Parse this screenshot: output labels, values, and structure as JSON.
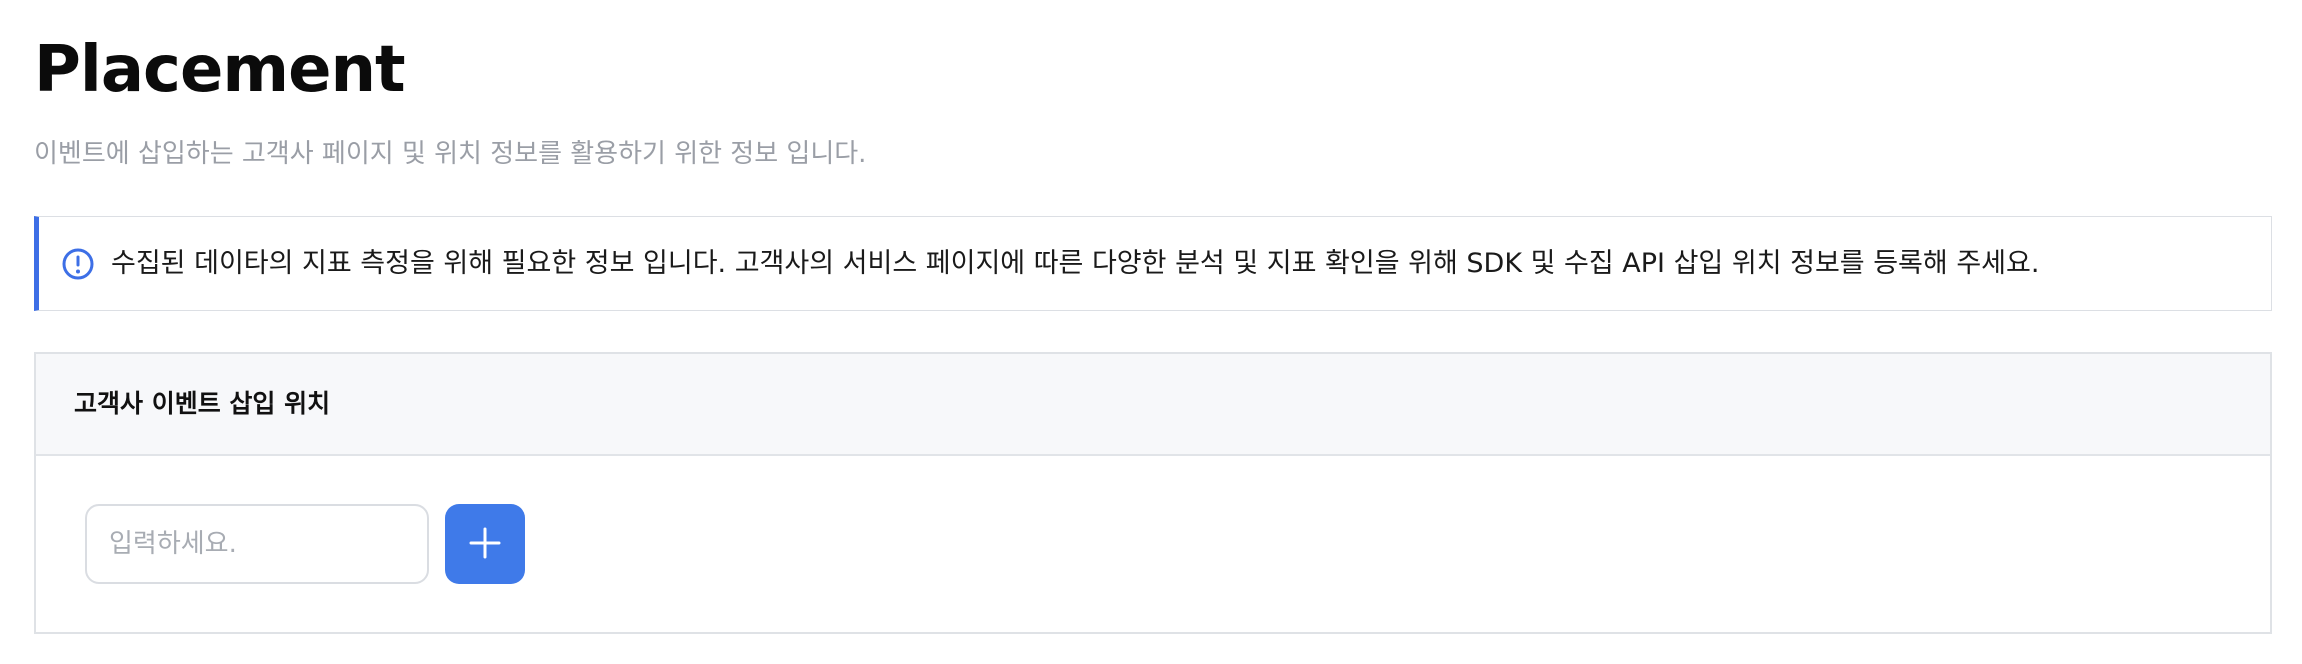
{
  "header": {
    "title": "Placement",
    "subtitle": "이벤트에 삽입하는 고객사 페이지 및 위치 정보를 활용하기 위한 정보 입니다."
  },
  "notice": {
    "icon": "info-circle-icon",
    "text": "수집된 데이타의 지표 측정을 위해 필요한 정보 입니다. 고객사의 서비스 페이지에 따른 다양한 분석 및 지표 확인을 위해 SDK 및 수집 API 삽입 위치 정보를 등록해 주세요.",
    "accent_color": "#3d6fe6"
  },
  "placement_section": {
    "title": "고객사 이벤트 삽입 위치",
    "input": {
      "value": "",
      "placeholder": "입력하세요."
    },
    "add_button": {
      "icon": "plus-icon",
      "color": "#3f7ae9"
    }
  }
}
